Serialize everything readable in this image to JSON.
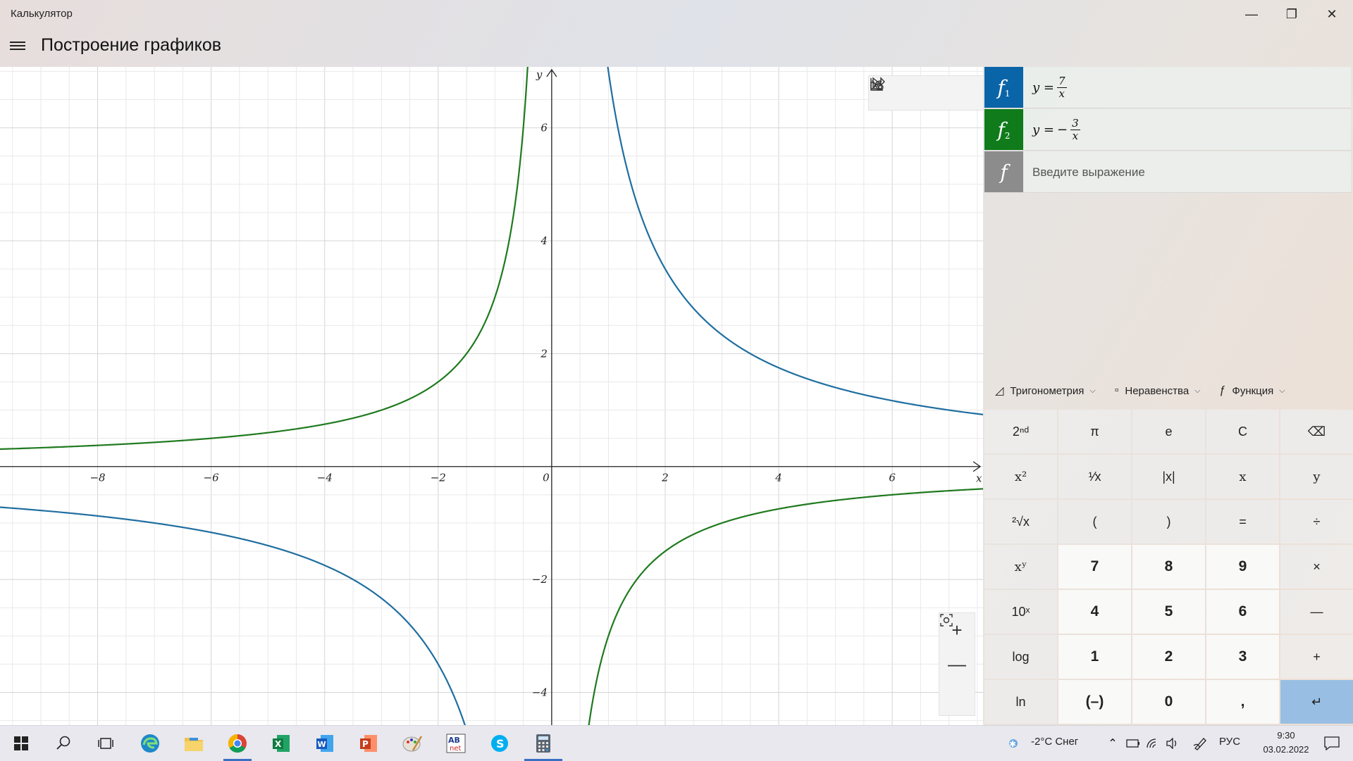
{
  "window": {
    "title": "Калькулятор",
    "minimize": "—",
    "maximize": "❐",
    "close": "✕"
  },
  "header": {
    "title": "Построение графиков"
  },
  "graph": {
    "axis_x_label": "x",
    "axis_y_label": "y",
    "x_ticks": [
      -8,
      -6,
      -4,
      -2,
      0,
      2,
      4,
      6
    ],
    "y_ticks": [
      6,
      4,
      2,
      -2,
      -4
    ],
    "x_range": [
      -9.72,
      7.6
    ],
    "y_range": [
      -4.58,
      7.08
    ],
    "colors": {
      "f1": "#1f6ea0",
      "f2": "#1f7a1f",
      "grid_minor": "#e9e9e9",
      "grid_major": "#d4d4d4",
      "axis": "#222222"
    },
    "zoom_in": "+",
    "zoom_out": "—"
  },
  "chart_data": {
    "type": "line",
    "series": [
      {
        "expr": "7/x",
        "numerator": 7,
        "color": "#1f6ea0"
      },
      {
        "expr": "-3/x",
        "numerator": -3,
        "color": "#1f7a1f"
      }
    ],
    "xlabel": "x",
    "ylabel": "y",
    "xlim": [
      -9.72,
      7.6
    ],
    "ylim": [
      -4.58,
      7.08
    ],
    "grid": true
  },
  "functions": [
    {
      "letter": "f",
      "index": "1",
      "lhs": "y =",
      "sign": "",
      "num": "7",
      "den": "x",
      "color": "#0a64a8"
    },
    {
      "letter": "f",
      "index": "2",
      "lhs": "y =",
      "sign": "−",
      "num": "3",
      "den": "x",
      "color": "#0f7b1a"
    }
  ],
  "new_function": {
    "letter": "f",
    "placeholder": "Введите выражение",
    "color": "#8c8c8c"
  },
  "categories": [
    {
      "icon": "◿",
      "label": "Тригонометрия"
    },
    {
      "icon": "▫",
      "label": "Неравенства"
    },
    {
      "icon": "ƒ",
      "label": "Функция"
    }
  ],
  "keys": [
    [
      "2ⁿᵈ",
      "π",
      "e",
      "C",
      "⌫"
    ],
    [
      "x²",
      "¹⁄x",
      "|x|",
      "x",
      "y"
    ],
    [
      "²√x",
      "(",
      ")",
      "=",
      "÷"
    ],
    [
      "xʸ",
      "7",
      "8",
      "9",
      "×"
    ],
    [
      "10ˣ",
      "4",
      "5",
      "6",
      "—"
    ],
    [
      "log",
      "1",
      "2",
      "3",
      "+"
    ],
    [
      "ln",
      "(–)",
      "0",
      ",",
      "↵"
    ]
  ],
  "taskbar": {
    "weather": "-2°C  Снег",
    "language": "РУС",
    "time": "9:30",
    "date": "03.02.2022"
  }
}
